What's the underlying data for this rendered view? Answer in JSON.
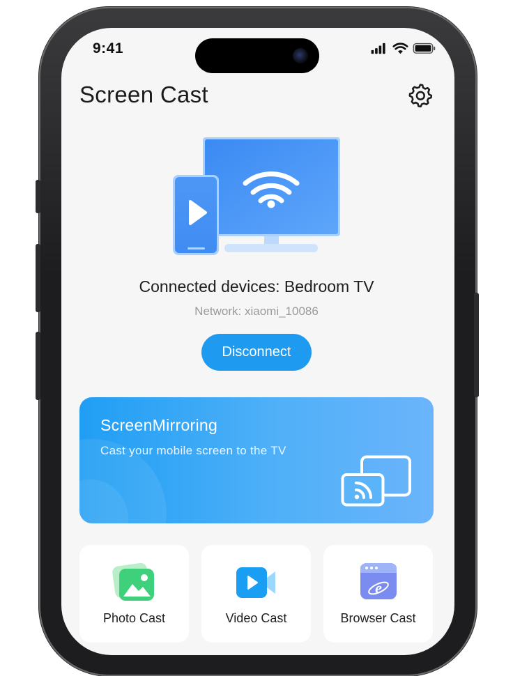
{
  "status_bar": {
    "time": "9:41"
  },
  "header": {
    "title": "Screen Cast",
    "settings_icon": "gear-icon"
  },
  "connection": {
    "connected_text": "Connected devices: Bedroom TV",
    "network_text": "Network: xiaomi_10086",
    "disconnect_label": "Disconnect"
  },
  "mirroring": {
    "title": "ScreenMirroring",
    "subtitle": "Cast your mobile screen to the TV",
    "icon": "screen-cast-icon"
  },
  "features": [
    {
      "label": "Photo Cast",
      "icon": "photo-icon"
    },
    {
      "label": "Video Cast",
      "icon": "video-camera-icon"
    },
    {
      "label": "Browser Cast",
      "icon": "browser-icon"
    }
  ],
  "colors": {
    "accent": "#1e9bf0",
    "card_gradient_start": "#209ef4",
    "card_gradient_end": "#6bb4fb",
    "background": "#f6f6f6"
  }
}
